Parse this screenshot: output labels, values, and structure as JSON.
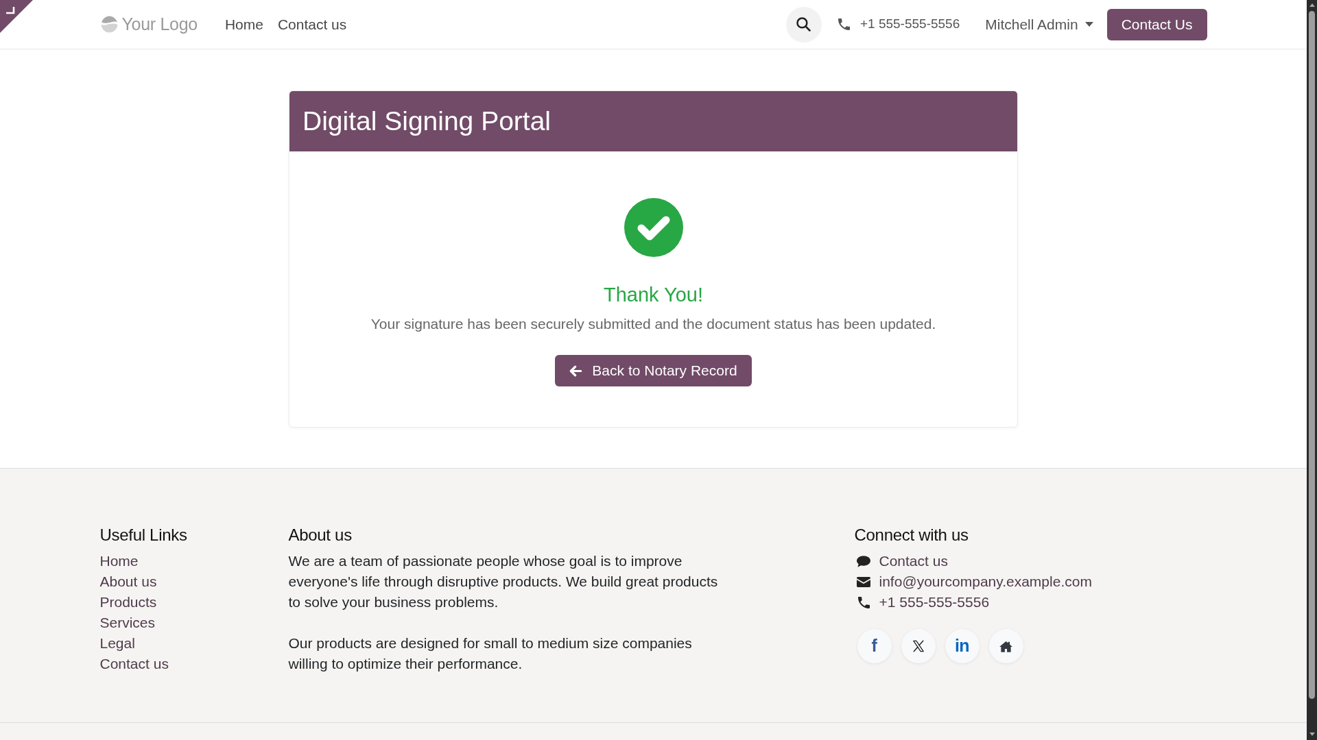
{
  "header": {
    "logo": "Your Logo",
    "nav": [
      "Home",
      "Contact us"
    ],
    "phone": "+1 555-555-5556",
    "user": "Mitchell Admin",
    "cta": "Contact Us"
  },
  "card": {
    "title": "Digital Signing Portal",
    "heading": "Thank You!",
    "message": "Your signature has been securely submitted and the document status has been updated.",
    "button": "Back to Notary Record"
  },
  "footer": {
    "useful_links": {
      "title": "Useful Links",
      "links": [
        "Home",
        "About us",
        "Products",
        "Services",
        "Legal",
        "Contact us"
      ]
    },
    "about": {
      "title": "About us",
      "paragraphs": [
        "We are a team of passionate people whose goal is to improve everyone's life through disruptive products. We build great products to solve your business problems.",
        "Our products are designed for small to medium size companies willing to optimize their performance."
      ]
    },
    "connect": {
      "title": "Connect with us",
      "items": [
        {
          "kind": "chat",
          "text": "Contact us"
        },
        {
          "kind": "email",
          "text": "info@yourcompany.example.com"
        },
        {
          "kind": "phone",
          "text": "+1 555-555-5556"
        }
      ],
      "social": [
        {
          "kind": "letters",
          "glyph": "f",
          "color": "#3b5998"
        },
        {
          "kind": "x",
          "color": "#222222"
        },
        {
          "kind": "letters",
          "glyph": "in",
          "color": "#0a66c2"
        },
        {
          "kind": "home",
          "color": "#343a40"
        }
      ]
    }
  }
}
